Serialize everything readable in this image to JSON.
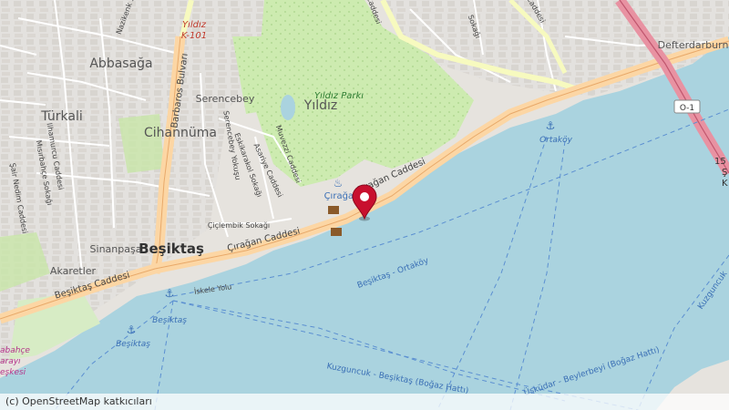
{
  "map": {
    "districts": {
      "abbasaga": "Abbasağa",
      "turkali": "Türkali",
      "cihannuma": "Cihannüma",
      "serencebey": "Serencebey",
      "yildiz": "Yıldız",
      "besiktas": "Beşiktaş",
      "sinanpasa": "Sinanpaşa",
      "akaretler": "Akaretler",
      "defterdarburnu": "Defterdarburnu"
    },
    "parks": {
      "yildiz_parki": "Yıldız Parkı"
    },
    "poi": {
      "ciragan": "Çırağan"
    },
    "roads": {
      "ciragan_caddesi_east": "Çırağan Caddesi",
      "ciragan_caddesi_west": "Çırağan Caddesi",
      "besiktas_caddesi": "Beşiktaş Caddesi",
      "barbaros_bulvari": "Barbaros Bulvarı",
      "yildiz_k101_a": "Yıldız",
      "yildiz_k101_b": "K-101",
      "o1_shield": "O-1",
      "muvezzi": "Muvezzi Caddesi",
      "serencebey_yokusu": "Serencebey Yokuşu",
      "eskikarakol": "Eskikarakol Sokağı",
      "asariye": "Asariye Caddesi",
      "ciclembik": "Çiçlembik Sokağı",
      "iskele_yolu": "İskele Yolu",
      "ilhamurcu": "Ilhamurcu Caddesi",
      "sair_nedim": "Şair Nedim Caddesi",
      "misirbahce": "Mısırbahçe Sokağı",
      "nazikenk": "Nazikenk Sok.",
      "top_caddesi": "Caddesi",
      "top_sokagi": "Sokağı",
      "top_caddesi_b": "Caddesi"
    },
    "ferry": {
      "besiktas_ortakoy": "Beşiktaş - Ortaköy",
      "kuzguncuk_besiktas": "Kuzguncuk - Beşiktaş (Boğaz Hattı)",
      "uskudar_beylerbeyi": "Üsküdar - Beylerbeyi (Boğaz Hattı)",
      "east_route": "Kuzguncuk"
    },
    "piers": {
      "ortakoy": "Ortaköy",
      "besiktas_1": "Beşiktaş",
      "besiktas_2": "Beşiktaş"
    },
    "edge_labels": {
      "dolmabahce_1": "abahçe",
      "dolmabahce_2": "arayı",
      "dolmabahce_3": "eşkesi",
      "bridge_1": "15",
      "bridge_2": "Ş",
      "bridge_3": "K"
    },
    "marker": {
      "name": "location-marker"
    },
    "colors": {
      "water": "#aad3df",
      "land": "#f2efe9",
      "urban": "#e0dfdf",
      "park": "#cdebb0",
      "primary_road": "#fcd6a4",
      "motorway": "#e892a2",
      "marker": "#c8102e"
    }
  },
  "attribution": "(c) OpenStreetMap katkıcıları"
}
